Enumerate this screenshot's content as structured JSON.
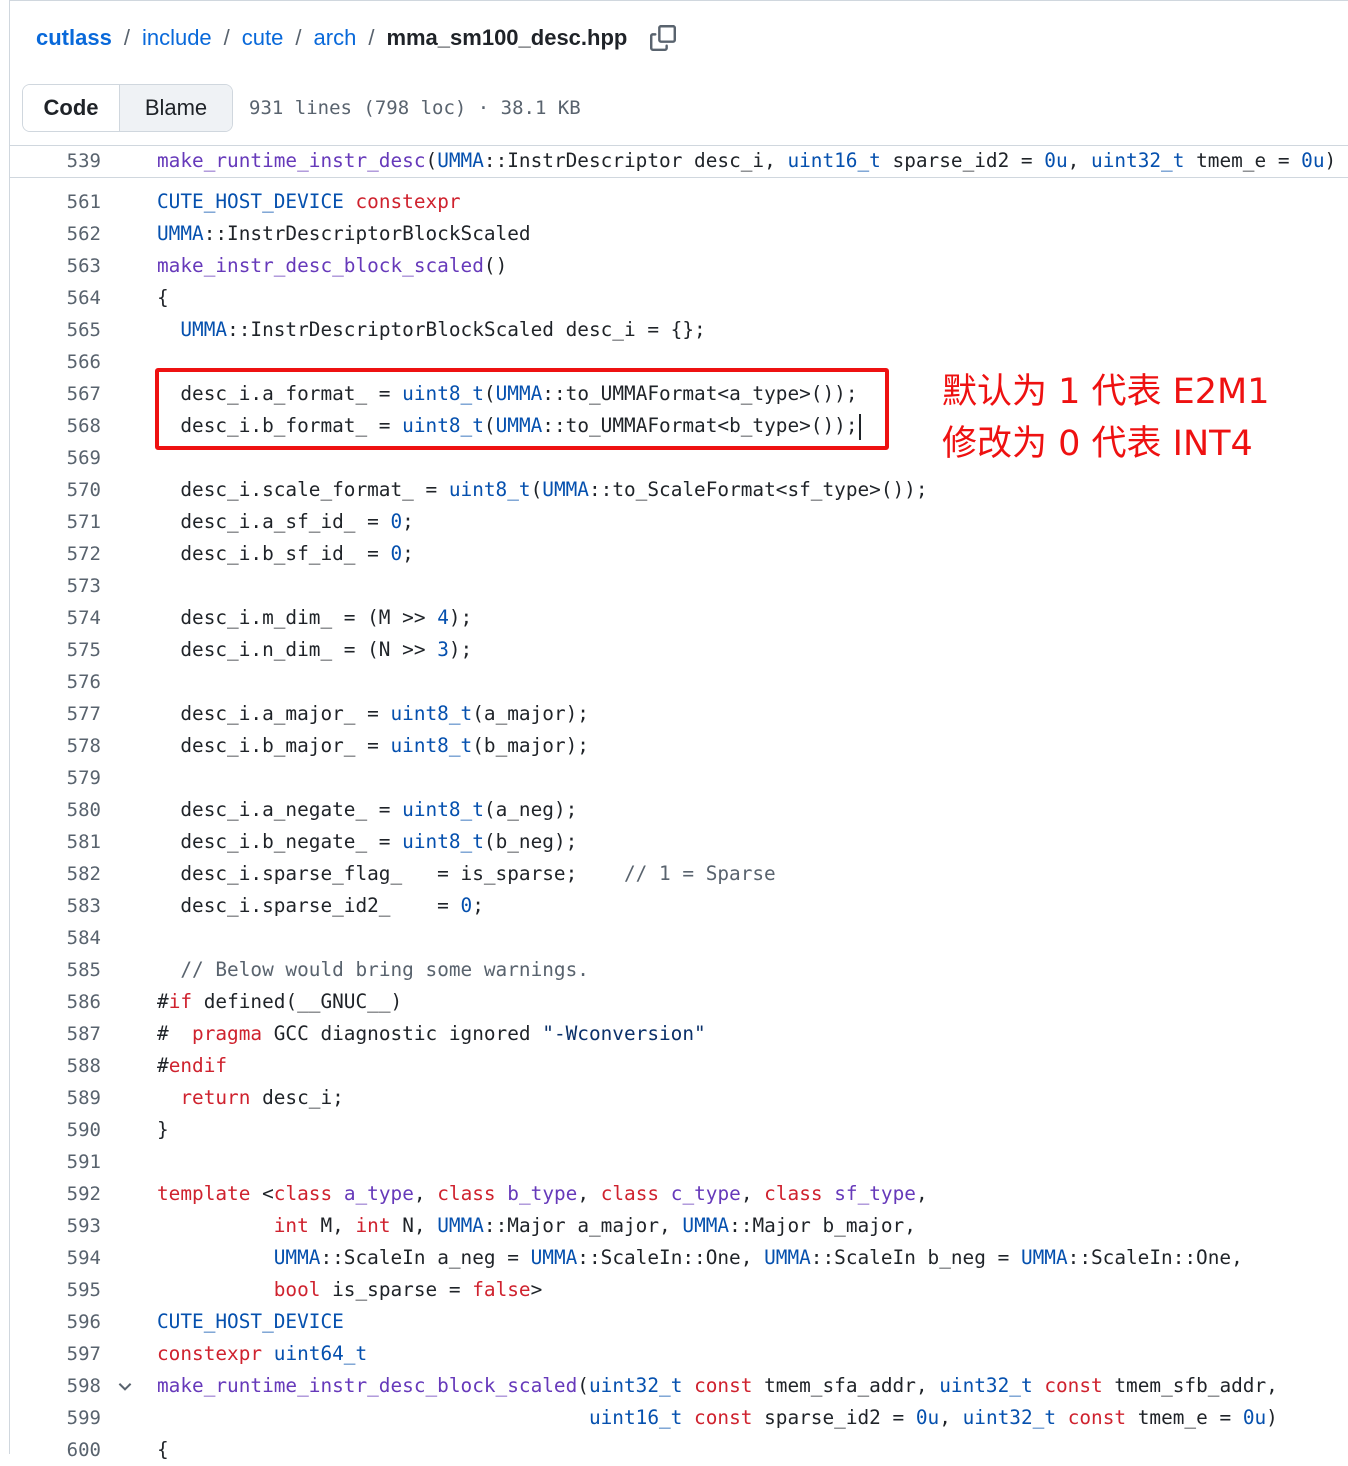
{
  "breadcrumb": {
    "repo": "cutlass",
    "sep": "/",
    "parts": [
      "include",
      "cute",
      "arch"
    ],
    "file": "mma_sm100_desc.hpp"
  },
  "toolbar": {
    "code_label": "Code",
    "blame_label": "Blame",
    "meta": "931 lines (798 loc) · 38.1 KB"
  },
  "sticky_line": {
    "number": "539",
    "code": "make_runtime_instr_desc(UMMA::InstrDescriptor desc_i, uint16_t sparse_id2 = 0u, uint32_t tmem_e = 0u)"
  },
  "code_lines": [
    {
      "n": "561",
      "code": "CUTE_HOST_DEVICE constexpr"
    },
    {
      "n": "562",
      "code": "UMMA::InstrDescriptorBlockScaled"
    },
    {
      "n": "563",
      "code": "make_instr_desc_block_scaled()"
    },
    {
      "n": "564",
      "code": "{"
    },
    {
      "n": "565",
      "code": "  UMMA::InstrDescriptorBlockScaled desc_i = {};"
    },
    {
      "n": "566",
      "code": ""
    },
    {
      "n": "567",
      "code": "  desc_i.a_format_ = uint8_t(UMMA::to_UMMAFormat<a_type>());"
    },
    {
      "n": "568",
      "code": "  desc_i.b_format_ = uint8_t(UMMA::to_UMMAFormat<b_type>());"
    },
    {
      "n": "569",
      "code": ""
    },
    {
      "n": "570",
      "code": "  desc_i.scale_format_ = uint8_t(UMMA::to_ScaleFormat<sf_type>());"
    },
    {
      "n": "571",
      "code": "  desc_i.a_sf_id_ = 0;"
    },
    {
      "n": "572",
      "code": "  desc_i.b_sf_id_ = 0;"
    },
    {
      "n": "573",
      "code": ""
    },
    {
      "n": "574",
      "code": "  desc_i.m_dim_ = (M >> 4);"
    },
    {
      "n": "575",
      "code": "  desc_i.n_dim_ = (N >> 3);"
    },
    {
      "n": "576",
      "code": ""
    },
    {
      "n": "577",
      "code": "  desc_i.a_major_ = uint8_t(a_major);"
    },
    {
      "n": "578",
      "code": "  desc_i.b_major_ = uint8_t(b_major);"
    },
    {
      "n": "579",
      "code": ""
    },
    {
      "n": "580",
      "code": "  desc_i.a_negate_ = uint8_t(a_neg);"
    },
    {
      "n": "581",
      "code": "  desc_i.b_negate_ = uint8_t(b_neg);"
    },
    {
      "n": "582",
      "code": "  desc_i.sparse_flag_   = is_sparse;    // 1 = Sparse"
    },
    {
      "n": "583",
      "code": "  desc_i.sparse_id2_    = 0;"
    },
    {
      "n": "584",
      "code": ""
    },
    {
      "n": "585",
      "code": "  // Below would bring some warnings."
    },
    {
      "n": "586",
      "code": "#if defined(__GNUC__)"
    },
    {
      "n": "587",
      "code": "#  pragma GCC diagnostic ignored \"-Wconversion\""
    },
    {
      "n": "588",
      "code": "#endif"
    },
    {
      "n": "589",
      "code": "  return desc_i;"
    },
    {
      "n": "590",
      "code": "}"
    },
    {
      "n": "591",
      "code": ""
    },
    {
      "n": "592",
      "code": "template <class a_type, class b_type, class c_type, class sf_type,"
    },
    {
      "n": "593",
      "code": "          int M, int N, UMMA::Major a_major, UMMA::Major b_major,"
    },
    {
      "n": "594",
      "code": "          UMMA::ScaleIn a_neg = UMMA::ScaleIn::One, UMMA::ScaleIn b_neg = UMMA::ScaleIn::One,"
    },
    {
      "n": "595",
      "code": "          bool is_sparse = false>"
    },
    {
      "n": "596",
      "code": "CUTE_HOST_DEVICE"
    },
    {
      "n": "597",
      "code": "constexpr uint64_t"
    },
    {
      "n": "598",
      "code": "make_runtime_instr_desc_block_scaled(uint32_t const tmem_sfa_addr, uint32_t const tmem_sfb_addr,"
    },
    {
      "n": "599",
      "code": "                                     uint16_t const sparse_id2 = 0u, uint32_t const tmem_e = 0u)"
    },
    {
      "n": "600",
      "code": "{"
    }
  ],
  "annotation": {
    "line1": "默认为 1 代表 E2M1",
    "line2": "修改为 0 代表 INT4",
    "color": "#ee1111"
  },
  "colors": {
    "link": "#0969da",
    "keyword": "#cf222e",
    "function": "#6639ba",
    "type": "#0550ae",
    "comment": "#59636e"
  }
}
